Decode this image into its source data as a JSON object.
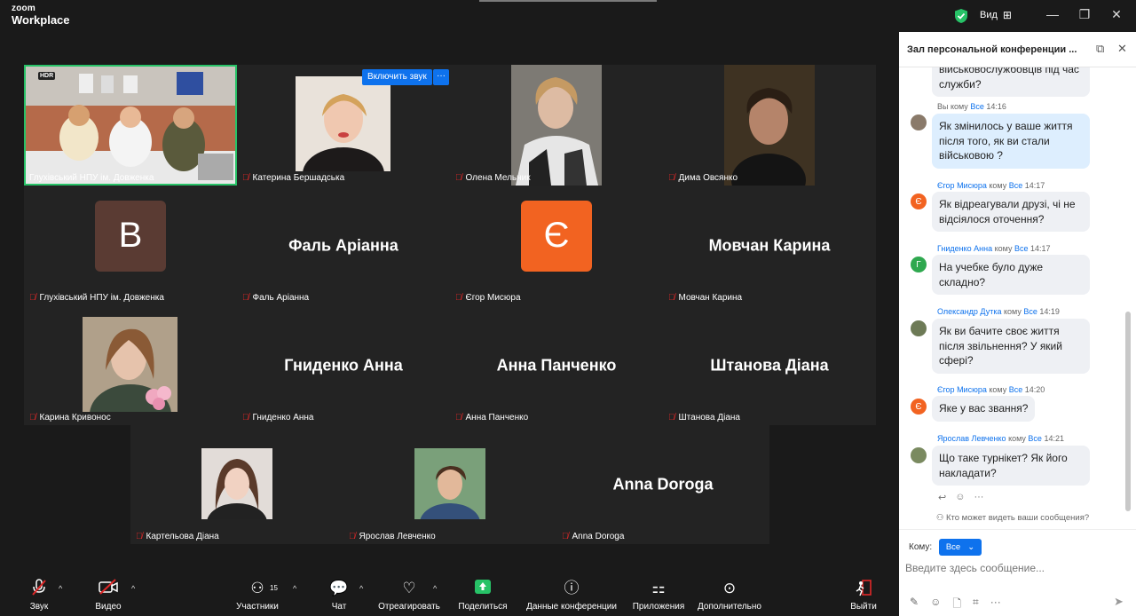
{
  "app": {
    "logo_line1": "zoom",
    "logo_line2": "Workplace",
    "view_label": "Вид"
  },
  "tiles": {
    "t1": {
      "name": "Глухівський НПУ ім. Довженка",
      "hdr": "HDR"
    },
    "t2": {
      "name": "Катерина Бершадська",
      "unmute_label": "Включить звук",
      "more": "···"
    },
    "t3": {
      "name": "Олена Мельник"
    },
    "t4": {
      "name": "Дима Овсянко"
    },
    "t5": {
      "name": "Глухівський НПУ ім. Довженка",
      "initial": "B",
      "initial_color": "#5a3b33"
    },
    "t6": {
      "name": "Фаль Аріанна",
      "big": "Фаль Аріанна"
    },
    "t7": {
      "name": "Єгор Мисюра",
      "initial": "Є",
      "initial_color": "#f26321"
    },
    "t8": {
      "name": "Мовчан Карина",
      "big": "Мовчан Карина"
    },
    "t9": {
      "name": "Карина Кривонос"
    },
    "t10": {
      "name": "Гниденко Анна",
      "big": "Гниденко Анна"
    },
    "t11": {
      "name": "Анна Панченко",
      "big": "Анна Панченко"
    },
    "t12": {
      "name": "Штанова Діана",
      "big": "Штанова Діана"
    },
    "t13": {
      "name": "Картельова Діана"
    },
    "t14": {
      "name": "Ярослав Левченко"
    },
    "t15": {
      "name": "Anna Doroga",
      "big": "Anna Doroga"
    }
  },
  "chat": {
    "title": "Зал персональной конференции ...",
    "m0": {
      "text": "військовослужбовців під час служби?"
    },
    "m1": {
      "from": "Вы кому",
      "to": "Все",
      "time": "14:16",
      "text": "Як змінилось у ваше життя після того, як ви стали військовою ?"
    },
    "m2": {
      "from": "Єгор Мисюра",
      "kw": "кому",
      "to": "Все",
      "time": "14:17",
      "text": "Як відреагували друзі, чі не відсіялося оточення?",
      "avatar": "Є"
    },
    "m3": {
      "from": "Гниденко Анна",
      "kw": "кому",
      "to": "Все",
      "time": "14:17",
      "text": "На учебке було дуже складно?",
      "avatar": "Г"
    },
    "m4": {
      "from": "Олександр Дутка",
      "kw": "кому",
      "to": "Все",
      "time": "14:19",
      "text": "Як ви бачите своє життя після звільнення? У який сфері?"
    },
    "m5": {
      "from": "Єгор Мисюра",
      "kw": "кому",
      "to": "Все",
      "time": "14:20",
      "text": "Яке у вас звання?",
      "avatar": "Є"
    },
    "m6": {
      "from": "Ярослав Левченко",
      "kw": "кому",
      "to": "Все",
      "time": "14:21",
      "text": "Що таке турнікет? Як його накладати?"
    },
    "who_sees": "Кто может видеть ваши сообщения?",
    "to_label": "Кому:",
    "to_value": "Все",
    "input_placeholder": "Введите здесь сообщение..."
  },
  "toolbar": {
    "audio": "Звук",
    "video": "Видео",
    "participants": "Участники",
    "participants_count": "15",
    "chat": "Чат",
    "react": "Отреагировать",
    "share": "Поделиться",
    "info": "Данные конференции",
    "apps": "Приложения",
    "more": "Дополнительно",
    "leave": "Выйти"
  },
  "colors": {
    "accent": "#0e72ed",
    "active_speaker": "#27c267",
    "share_green": "#27c267",
    "muted_red": "#e02828"
  }
}
